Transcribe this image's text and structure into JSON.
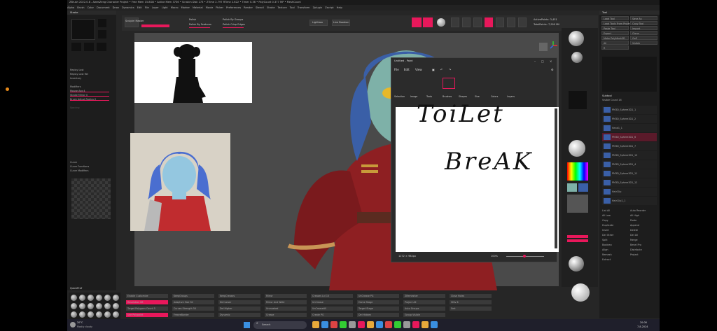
{
  "window": {
    "title": "ZBrush 2022.0.8 - AwesZeng Character Project  • Free Mem 15.8GB • Active Mem 3736 • Scratch Disk 273 • ZTime 2.797 RTime 2.622 • Timer 0.36 • PolyCount 0.377 MP • MeshCount"
  },
  "menu": {
    "items": [
      "Alpha",
      "Brush",
      "Color",
      "Document",
      "Draw",
      "Dynamics",
      "Edit",
      "File",
      "Layer",
      "Light",
      "Macro",
      "Marker",
      "Material",
      "Movie",
      "Picker",
      "Preferences",
      "Render",
      "Stencil",
      "Stroke",
      "Texture",
      "Tool",
      "Transform",
      "Zplugin",
      "Zscript",
      "Help"
    ],
    "right": [
      "QuickSave",
      "See-through",
      "Menus",
      "DefaultZScript"
    ]
  },
  "left_panel": {
    "header": "Stroke",
    "items": [
      {
        "label": "Replay Last",
        "dim": false
      },
      {
        "label": "Replay Last Rel",
        "dim": false
      },
      {
        "label": "Inventory",
        "dim": false
      },
      {
        "label": "Modifiers",
        "dim": false
      },
      {
        "label": "Mouse Avg 4",
        "dim": false
      },
      {
        "label": "Stroke Mirror 0",
        "dim": false
      },
      {
        "label": "Brush Adjust Radius 0",
        "dim": false
      },
      {
        "label": "Spacing",
        "dim": true
      },
      {
        "label": "Curve",
        "dim": false
      },
      {
        "label": "Curve Functions",
        "dim": false
      },
      {
        "label": "Curve Modifiers",
        "dim": false
      },
      {
        "label": "Inventory",
        "dim": false
      },
      {
        "label": "Curves Helper",
        "dim": false
      }
    ],
    "bottom_header": "QuickPref"
  },
  "right_panel": {
    "header": "Tool",
    "buttons": [
      "Load Tool",
      "Save As",
      "Load Tools From Project",
      "Copy Tool",
      "Paste Tool",
      "Import",
      "Export",
      "Clone",
      "Make PolyMesh3D",
      "GoZ",
      "All",
      "Visible",
      "R"
    ],
    "subtool": "Subtool",
    "visible_count": "Visible Count 16",
    "subtools": [
      "PM3D_Sphere3D1_1",
      "PM3D_Sphere3D1_2",
      "Hand1_1",
      "PM3D_Sphere3D1_6",
      "PM3D_Sphere3D1_7",
      "PM3D_Sphere3D1_13",
      "PM3D_Sphere3D1_4",
      "PM3D_Sphere3D1_11",
      "PM3D_Sphere3D1_12",
      "HairClip",
      "HairClip1_1"
    ],
    "actions": [
      "List All",
      "Auto Reorder",
      "All Low",
      "All High",
      "Copy",
      "Paste",
      "Duplicate",
      "Append",
      "Insert",
      "Delete",
      "Del Other",
      "Del All",
      "Split",
      "Merge",
      "Boolean",
      "Bevel Pro",
      "Align",
      "Distribute",
      "Remesh",
      "Project",
      "Extract"
    ]
  },
  "top_toolbar": {
    "items": [
      "Sculptrl Master",
      "Polish",
      "Polish By Features",
      "Polish By Groups",
      "Polish Crisp Edges",
      "Lightbox",
      "Live Boolean",
      "Edit",
      "Draw",
      "Move",
      "Scale",
      "Rotate"
    ],
    "active_points": "ActivePoints: 3,451",
    "total_points": "TotalPoints: 7,900 Mil"
  },
  "bottom_toolbar": {
    "items": [
      "Enable Customize",
      "Resolution 88",
      "Target Polygons Count 5",
      "Use Polypaint",
      "KeepGroups",
      "Adaptive Size 50",
      "Curves Strength 50",
      "FreezeBorder",
      "KeepCreases",
      "Del Lower",
      "Del Higher",
      "Dynamic",
      "Mirror",
      "Mirror And Weld",
      "Unmasked",
      "Crease",
      "Creases Lvl 15",
      "UnCrease",
      "UnCreaseAll",
      "Create PG",
      "UnCrease PG",
      "Home Stage",
      "Target Stage",
      "Del Hidden",
      "ZRemesher",
      "Project All",
      "Auto Groups",
      "Group Visible",
      "Close Holes",
      "SDiv 6",
      "Smt"
    ]
  },
  "paint": {
    "title": "Untitled - Paint",
    "menu": [
      "File",
      "Edit",
      "View"
    ],
    "tools": [
      "Selection",
      "Image",
      "Tools",
      "Brushes",
      "Shapes",
      "Size",
      "Colors",
      "Layers"
    ],
    "status_size": "1272 × 984px",
    "zoom": "100%",
    "drawing_text": [
      "ToiLet",
      "BreAK"
    ]
  },
  "taskbar": {
    "search": "Search",
    "weather_temp": "20°C",
    "weather_desc": "Mostly cloudy",
    "time": "20:08",
    "date": "7-8-2024"
  },
  "colors": {
    "accent": "#e8185b",
    "panel": "#1d1d1d",
    "viewport": "#4a4a4a",
    "robe": "#8e1f22",
    "skin": "#7eb1a8",
    "hair": "#3a5fa7"
  }
}
